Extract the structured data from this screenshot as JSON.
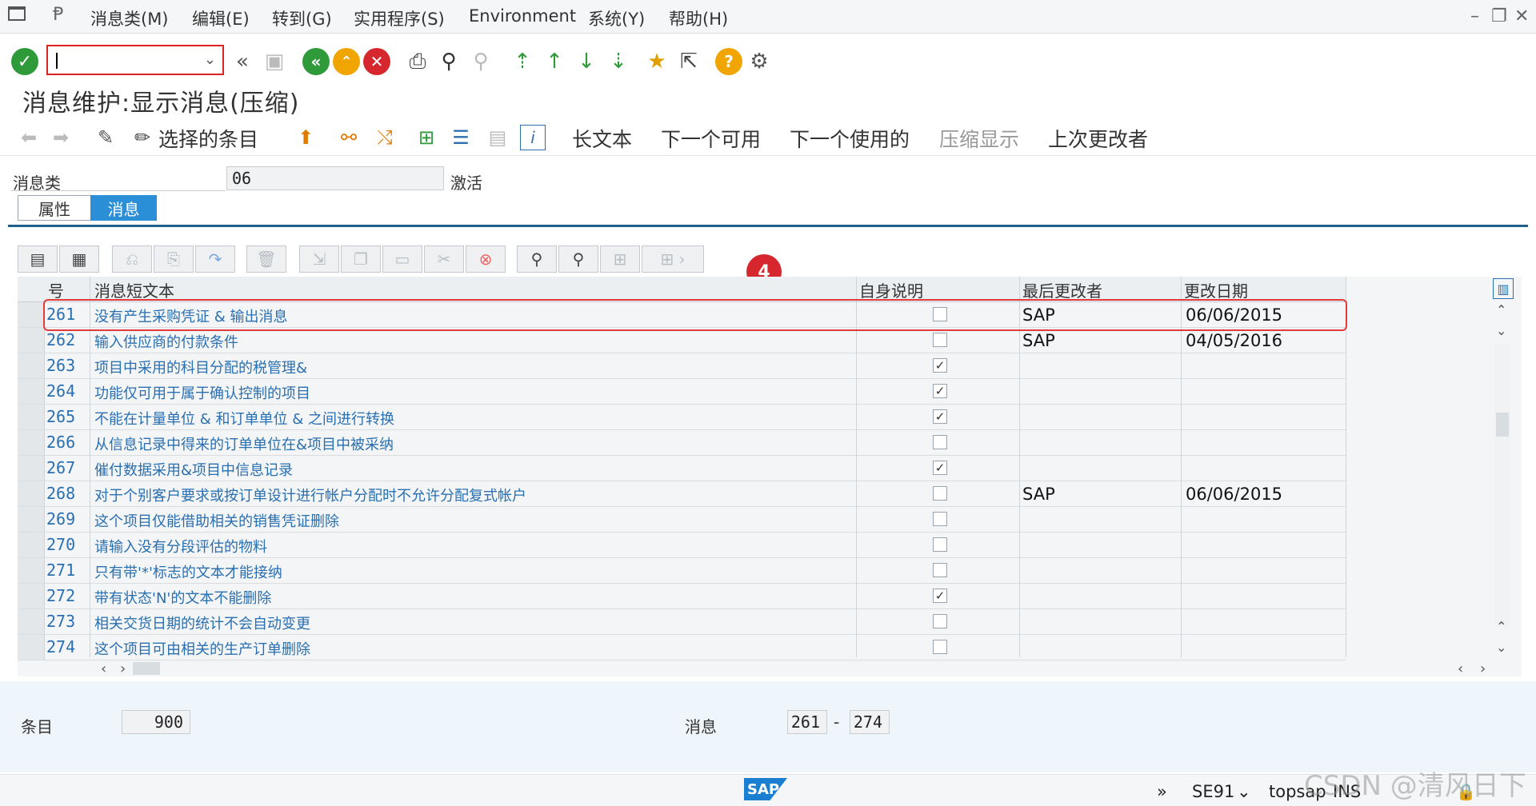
{
  "menu": {
    "items": [
      "消息类(M)",
      "编辑(E)",
      "转到(G)",
      "实用程序(S)",
      "Environment",
      "系统(Y)",
      "帮助(H)"
    ],
    "window_controls": [
      "–",
      "❐",
      "✕"
    ]
  },
  "toolbar": {
    "command_field": {
      "value": "",
      "placeholder": ""
    }
  },
  "title": "消息维护:显示消息(压缩)",
  "app_toolbar": {
    "selected_entries": "选择的条目",
    "long_text": "长文本",
    "next_available": "下一个可用",
    "next_used": "下一个使用的",
    "compress_display": "压缩显示",
    "last_changed_by": "上次更改者"
  },
  "header": {
    "message_class_label": "消息类",
    "message_class_value": "06",
    "status": "激活"
  },
  "tabs": {
    "properties": "属性",
    "messages": "消息"
  },
  "step_badge": "4",
  "table": {
    "columns": [
      "号",
      "消息短文本",
      "自身说明",
      "最后更改者",
      "更改日期"
    ],
    "rows": [
      {
        "num": "261",
        "text": "没有产生采购凭证 & 输出消息",
        "self_explanatory": false,
        "changed_by": "SAP",
        "date": "06/06/2015"
      },
      {
        "num": "262",
        "text": "输入供应商的付款条件",
        "self_explanatory": false,
        "changed_by": "SAP",
        "date": "04/05/2016"
      },
      {
        "num": "263",
        "text": "项目中采用的科目分配的税管理&",
        "self_explanatory": true,
        "changed_by": "",
        "date": ""
      },
      {
        "num": "264",
        "text": "功能仅可用于属于确认控制的项目",
        "self_explanatory": true,
        "changed_by": "",
        "date": ""
      },
      {
        "num": "265",
        "text": "不能在计量单位 & 和订单单位 & 之间进行转换",
        "self_explanatory": true,
        "changed_by": "",
        "date": ""
      },
      {
        "num": "266",
        "text": "从信息记录中得来的订单单位在&项目中被采纳",
        "self_explanatory": false,
        "changed_by": "",
        "date": ""
      },
      {
        "num": "267",
        "text": "催付数据采用&项目中信息记录",
        "self_explanatory": true,
        "changed_by": "",
        "date": ""
      },
      {
        "num": "268",
        "text": "对于个别客户要求或按订单设计进行帐户分配时不允许分配复式帐户",
        "self_explanatory": false,
        "changed_by": "SAP",
        "date": "06/06/2015"
      },
      {
        "num": "269",
        "text": "这个项目仅能借助相关的销售凭证删除",
        "self_explanatory": false,
        "changed_by": "",
        "date": ""
      },
      {
        "num": "270",
        "text": "请输入没有分段评估的物料",
        "self_explanatory": false,
        "changed_by": "",
        "date": ""
      },
      {
        "num": "271",
        "text": "只有带'*'标志的文本才能接纳",
        "self_explanatory": false,
        "changed_by": "",
        "date": ""
      },
      {
        "num": "272",
        "text": "带有状态'N'的文本不能删除",
        "self_explanatory": true,
        "changed_by": "",
        "date": ""
      },
      {
        "num": "273",
        "text": "相关交货日期的统计不会自动变更",
        "self_explanatory": false,
        "changed_by": "",
        "date": ""
      },
      {
        "num": "274",
        "text": "这个项目可由相关的生产订单删除",
        "self_explanatory": false,
        "changed_by": "",
        "date": ""
      }
    ]
  },
  "footer": {
    "entries_label": "条目",
    "entries_value": "900",
    "messages_label": "消息",
    "from": "261",
    "dash": "-",
    "to": "274"
  },
  "status_bar": {
    "logo": "SAP",
    "transaction": "SE91",
    "system": "topsap",
    "mode": "INS"
  },
  "watermark": "CSDN @清风日下"
}
